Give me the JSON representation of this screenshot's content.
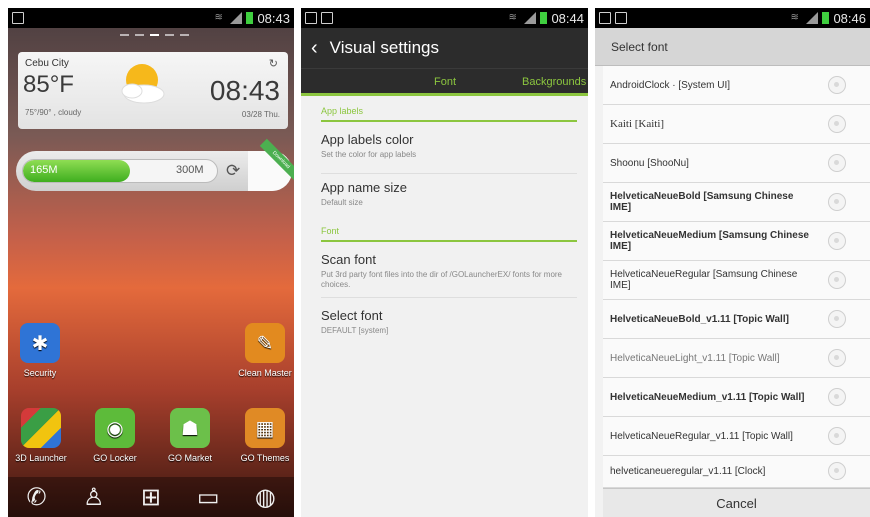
{
  "panel1": {
    "statusbar": {
      "time": "08:43"
    },
    "weather": {
      "city": "Cebu City",
      "temp": "85°F",
      "condition": "75°/90° , cloudy",
      "time": "08:43",
      "date": "03/28 Thu."
    },
    "memory": {
      "used": "165M",
      "total": "300M",
      "used_fraction": 0.55,
      "ribbon": "Download"
    },
    "apps": [
      {
        "label": "Security",
        "icon": "security-icon",
        "color": "#2f74d6"
      },
      {
        "label": "Clean Master",
        "icon": "broom-icon",
        "color": "#e28a1f"
      },
      {
        "label": "3D Launcher",
        "icon": "launcher-icon",
        "color": "#3a9e45"
      },
      {
        "label": "GO Locker",
        "icon": "lock-icon",
        "color": "#5dbb3a"
      },
      {
        "label": "GO Market",
        "icon": "market-icon",
        "color": "#6cc04a"
      },
      {
        "label": "GO Themes",
        "icon": "themes-icon",
        "color": "#e08a25"
      }
    ],
    "dock": [
      "phone-icon",
      "contacts-icon",
      "apps-grid-icon",
      "messages-icon",
      "browser-icon"
    ]
  },
  "panel2": {
    "statusbar": {
      "time": "08:44"
    },
    "title": "Visual settings",
    "tabs": [
      "Font",
      "Backgrounds"
    ],
    "section_app_labels": "App labels",
    "items_app_labels": [
      {
        "title": "App labels color",
        "subtitle": "Set the color for app labels"
      },
      {
        "title": "App name size",
        "subtitle": "Default size"
      }
    ],
    "section_font": "Font",
    "items_font": [
      {
        "title": "Scan font",
        "subtitle": "Put 3rd party font files into the dir of /GOLauncherEX/ fonts for more choices."
      },
      {
        "title": "Select font",
        "subtitle": "DEFAULT [system]"
      }
    ],
    "accent": "#8cc63f"
  },
  "panel3": {
    "statusbar": {
      "time": "08:46"
    },
    "title": "Select font",
    "fonts": [
      "AndroidClock · [System UI]",
      "Kaiti [Kaiti]",
      "Shoonu [ShooNu]",
      "HelveticaNeueBold [Samsung Chinese IME]",
      "HelveticaNeueMedium [Samsung Chinese IME]",
      "HelveticaNeueRegular [Samsung Chinese IME]",
      "HelveticaNeueBold_v1.11 [Topic Wall]",
      "HelveticaNeueLight_v1.11 [Topic Wall]",
      "HelveticaNeueMedium_v1.11 [Topic Wall]",
      "HelveticaNeueRegular_v1.11 [Topic Wall]",
      "helveticaneueregular_v1.11 [Clock]"
    ],
    "cancel": "Cancel"
  }
}
